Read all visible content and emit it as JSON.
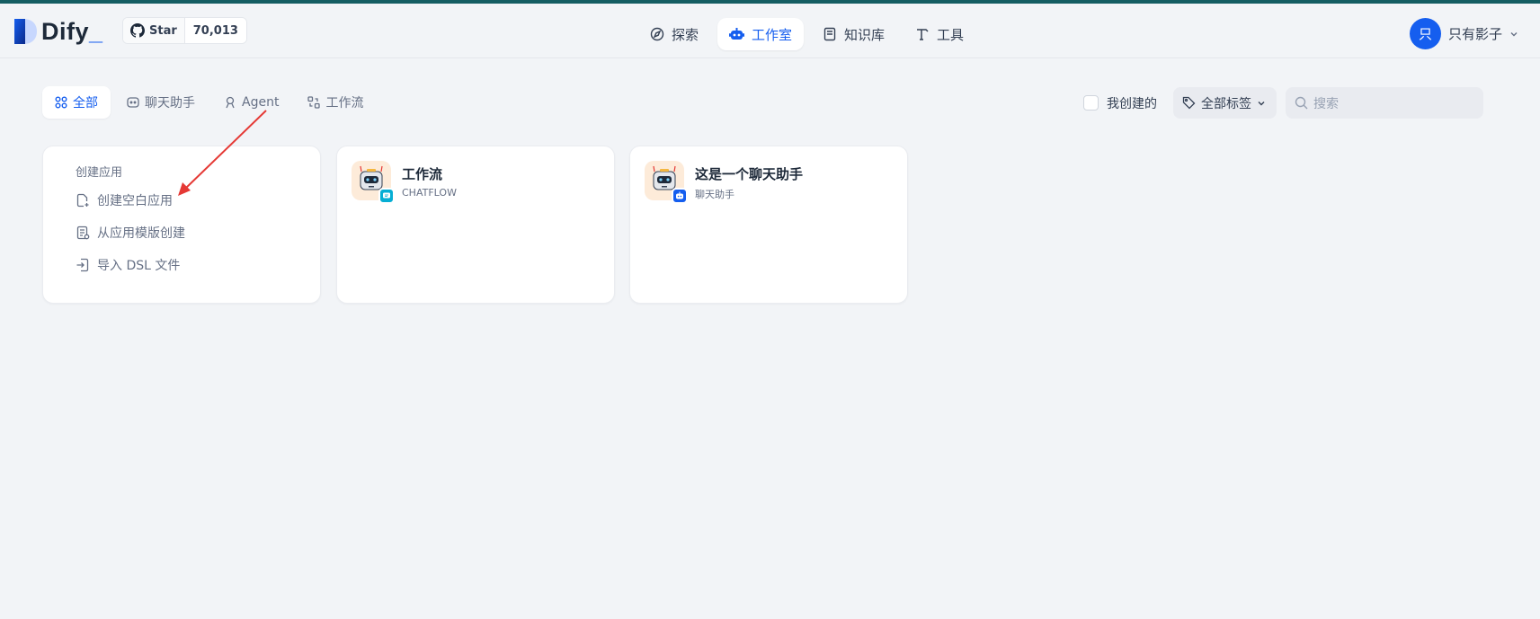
{
  "header": {
    "logo_text": "Dify",
    "github": {
      "star_label": "Star",
      "count": "70,013"
    },
    "nav": [
      {
        "label": "探索",
        "icon": "compass-icon"
      },
      {
        "label": "工作室",
        "icon": "robot-icon"
      },
      {
        "label": "知识库",
        "icon": "book-icon"
      },
      {
        "label": "工具",
        "icon": "hammer-icon"
      }
    ],
    "active_nav": "工作室",
    "user": {
      "avatar_initial": "只",
      "name": "只有影子"
    }
  },
  "tabs": [
    {
      "label": "全部",
      "icon": "grid-icon"
    },
    {
      "label": "聊天助手",
      "icon": "chat-bot-icon"
    },
    {
      "label": "Agent",
      "icon": "agent-icon"
    },
    {
      "label": "工作流",
      "icon": "workflow-icon"
    }
  ],
  "active_tab": "全部",
  "filters": {
    "mine_label": "我创建的",
    "tag_label": "全部标签",
    "search_placeholder": "搜索"
  },
  "create_card": {
    "title": "创建应用",
    "items": [
      {
        "label": "创建空白应用",
        "icon": "file-plus-icon"
      },
      {
        "label": "从应用模版创建",
        "icon": "file-template-icon"
      },
      {
        "label": "导入 DSL 文件",
        "icon": "import-icon"
      }
    ]
  },
  "apps": [
    {
      "name": "工作流",
      "type": "CHATFLOW",
      "badge_color": "#06aed4"
    },
    {
      "name": "这是一个聊天助手",
      "type": "聊天助手",
      "badge_color": "#155eef"
    }
  ],
  "colors": {
    "accent": "#155eef",
    "topbar": "#155e63",
    "annotation_arrow": "#e53935"
  }
}
